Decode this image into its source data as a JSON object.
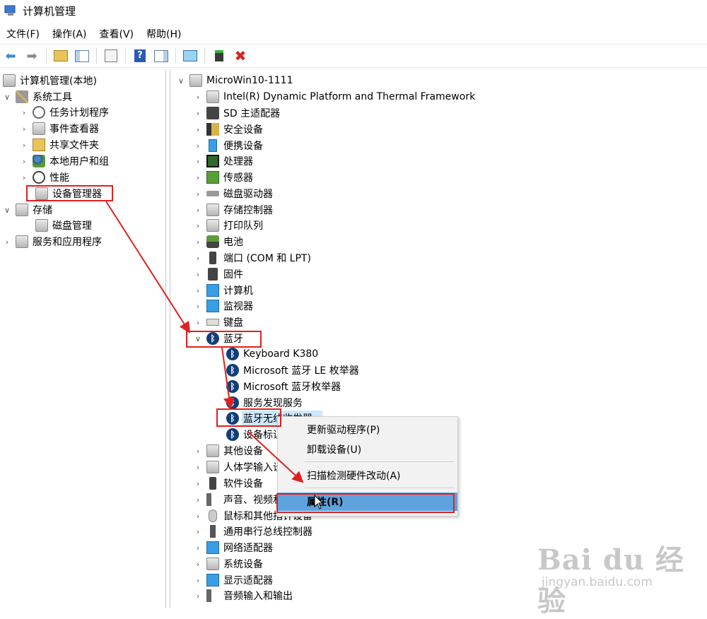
{
  "window": {
    "title": "计算机管理"
  },
  "menu": [
    "文件(F)",
    "操作(A)",
    "查看(V)",
    "帮助(H)"
  ],
  "toolbar": {
    "buttons": [
      {
        "name": "back-button",
        "icon": "arrow-left-icon"
      },
      {
        "name": "forward-button",
        "icon": "arrow-right-icon"
      },
      {
        "name": "up-folder-button",
        "icon": "folder-up-icon"
      },
      {
        "name": "show-hide-tree-button",
        "icon": "console-tree-icon"
      },
      {
        "name": "properties-toolbar-button",
        "icon": "properties-icon"
      },
      {
        "name": "help-button",
        "icon": "help-icon"
      },
      {
        "name": "action-pane-button",
        "icon": "pane-icon"
      },
      {
        "name": "scan-hardware-button",
        "icon": "monitor-scan-icon"
      },
      {
        "name": "update-driver-button",
        "icon": "update-driver-icon"
      },
      {
        "name": "uninstall-button",
        "icon": "red-x-icon"
      }
    ]
  },
  "left_tree": {
    "root": "计算机管理(本地)",
    "system_tools": "系统工具",
    "task_scheduler": "任务计划程序",
    "event_viewer": "事件查看器",
    "shared_folders": "共享文件夹",
    "local_users": "本地用户和组",
    "performance": "性能",
    "device_manager": "设备管理器",
    "storage": "存储",
    "disk_management": "磁盘管理",
    "services_apps": "服务和应用程序"
  },
  "device_tree": {
    "computer_name": "MicroWin10-1111",
    "categories": [
      "Intel(R) Dynamic Platform and Thermal Framework",
      "SD 主适配器",
      "安全设备",
      "便携设备",
      "处理器",
      "传感器",
      "磁盘驱动器",
      "存储控制器",
      "打印队列",
      "电池",
      "端口 (COM 和 LPT)",
      "固件",
      "计算机",
      "监视器",
      "键盘",
      "蓝牙"
    ],
    "bluetooth_children": [
      "Keyboard K380",
      "Microsoft 蓝牙 LE 枚举器",
      "Microsoft 蓝牙枚举器",
      "服务发现服务",
      "蓝牙无线收发器",
      "设备标识服务"
    ],
    "categories_after": [
      "其他设备",
      "人体学输入设备",
      "软件设备",
      "声音、视频和游戏控制器",
      "鼠标和其他指针设备",
      "通用串行总线控制器",
      "网络适配器",
      "系统设备",
      "显示适配器",
      "音频输入和输出"
    ]
  },
  "context_menu": {
    "update_driver": "更新驱动程序(P)",
    "uninstall": "卸载设备(U)",
    "scan": "扫描检测硬件改动(A)",
    "properties": "属性(R)"
  },
  "watermark": {
    "main": "Bai du 经验",
    "sub": "jingyan.baidu.com"
  },
  "colors": {
    "annotation_red": "#e02020",
    "selection_blue": "#cce8ff",
    "menu_highlight": "#5ea3dd",
    "bluetooth_icon": "#123e78"
  }
}
